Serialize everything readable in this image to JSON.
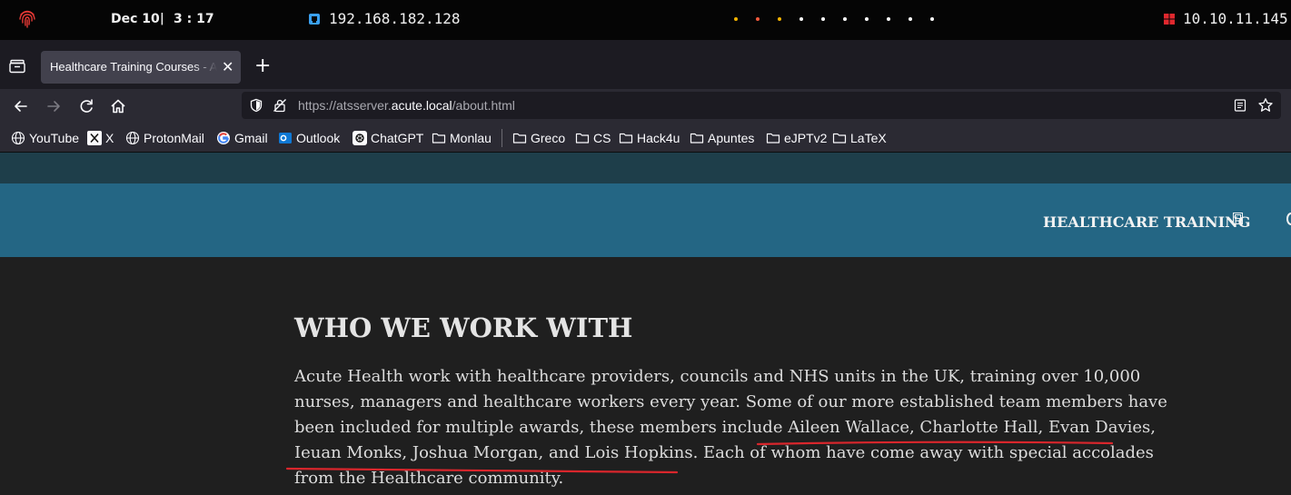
{
  "system_bar": {
    "date": "Dec 10",
    "separator": "|",
    "time": "3 : 17",
    "lan_ip": "192.168.182.128",
    "vpn_ip": "10.10.11.145",
    "workspace_dot_colors": [
      "#f5b400",
      "#f55a3c",
      "#f5b400",
      "#ffffff",
      "#ffffff",
      "#ffffff",
      "#ffffff",
      "#ffffff",
      "#ffffff",
      "#ffffff"
    ]
  },
  "browser": {
    "tab": {
      "title": "Healthcare Training Courses - Acute Health",
      "close_glyph": "✕"
    },
    "new_tab_glyph": "+",
    "url": {
      "prefix": "https://atsserver.",
      "host": "acute.local",
      "path": "/about.html"
    }
  },
  "bookmarks": [
    {
      "label": "YouTube",
      "icon": "globe-icon"
    },
    {
      "label": "X",
      "icon": "x-logo-icon"
    },
    {
      "label": "ProtonMail",
      "icon": "globe-icon"
    },
    {
      "label": "Gmail",
      "icon": "google-icon"
    },
    {
      "label": "Outlook",
      "icon": "outlook-icon"
    },
    {
      "label": "ChatGPT",
      "icon": "chatgpt-icon"
    },
    {
      "label": "Monlau",
      "icon": "folder-icon"
    },
    {
      "label": "Greco",
      "icon": "folder-icon"
    },
    {
      "label": "CS",
      "icon": "folder-icon"
    },
    {
      "label": "Hack4u",
      "icon": "folder-icon"
    },
    {
      "label": "Apuntes",
      "icon": "folder-icon"
    },
    {
      "label": "eJPTv2",
      "icon": "folder-icon"
    },
    {
      "label": "LaTeX",
      "icon": "folder-icon"
    }
  ],
  "site": {
    "brand": "HEALTHCARE TRAINING",
    "section_title": "WHO WE WORK WITH",
    "paragraph_lines": [
      "Acute Health work with healthcare providers, councils and NHS units in the UK, training over 10,000",
      "nurses, managers and healthcare workers every year. Some of our more established team members have",
      "been included for multiple awards, these members include Aileen Wallace, Charlotte Hall, Evan Davies,",
      "Ieuan Monks, Joshua Morgan, and Lois Hopkins. Each of whom have come away with special accolades",
      "from the Healthcare community."
    ]
  },
  "colors": {
    "annotation_underline": "#d9262c",
    "header_teal": "#246684",
    "page_background": "#1f1f1f"
  }
}
